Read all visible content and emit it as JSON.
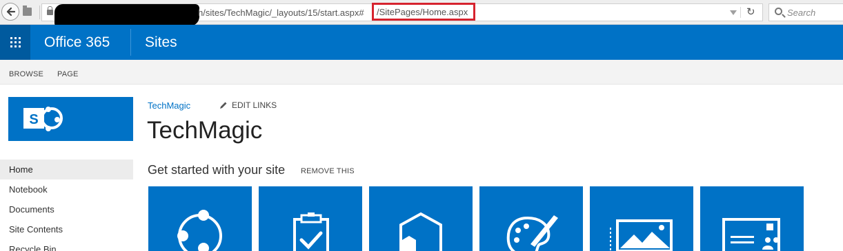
{
  "browser": {
    "url_visible": "h/sites/TechMagic/_layouts/15/start.aspx#",
    "url_highlight": "/SitePages/Home.aspx",
    "search_placeholder": "Search"
  },
  "suite_bar": {
    "brand": "Office 365",
    "app": "Sites",
    "color": "#0072c6"
  },
  "ribbon": {
    "tabs": [
      "BROWSE",
      "PAGE"
    ]
  },
  "header": {
    "breadcrumb": "TechMagic",
    "edit_links": "EDIT LINKS",
    "site_title": "TechMagic"
  },
  "left_nav": {
    "items": [
      "Home",
      "Notebook",
      "Documents",
      "Site Contents",
      "Recycle Bin"
    ],
    "selected": "Home"
  },
  "get_started": {
    "title": "Get started with your site",
    "remove": "REMOVE THIS",
    "tiles": [
      {
        "icon": "share-icon"
      },
      {
        "icon": "clipboard-check-icon"
      },
      {
        "icon": "hexagon-icon"
      },
      {
        "icon": "palette-brush-icon"
      },
      {
        "icon": "picture-icon"
      },
      {
        "icon": "contact-card-icon"
      }
    ]
  }
}
